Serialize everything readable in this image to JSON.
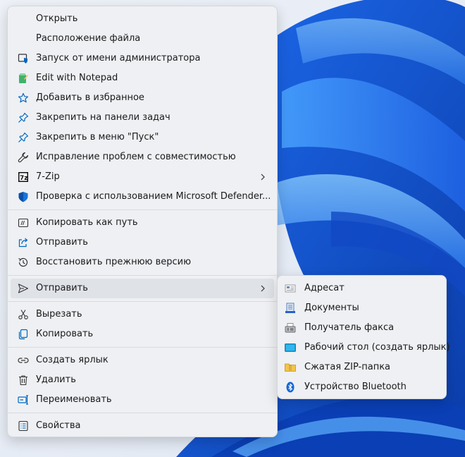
{
  "main_menu": {
    "group1": [
      {
        "label": "Открыть",
        "icon": "none"
      },
      {
        "label": "Расположение файла",
        "icon": "none"
      },
      {
        "label": "Запуск от имени администратора",
        "icon": "admin-shield-icon"
      },
      {
        "label": "Edit with Notepad",
        "icon": "notepad-icon"
      },
      {
        "label": "Добавить в избранное",
        "icon": "star-icon"
      },
      {
        "label": "Закрепить на панели задач",
        "icon": "pin-icon"
      },
      {
        "label": "Закрепить в меню \"Пуск\"",
        "icon": "pin-icon"
      },
      {
        "label": "Исправление проблем с совместимостью",
        "icon": "wrench-icon"
      },
      {
        "label": "7-Zip",
        "icon": "7zip-icon",
        "has_submenu": true
      },
      {
        "label": "Проверка с использованием Microsoft Defender...",
        "icon": "defender-shield-icon"
      }
    ],
    "group2": [
      {
        "label": "Копировать как путь",
        "icon": "copy-path-icon"
      },
      {
        "label": "Отправить",
        "icon": "share-icon"
      },
      {
        "label": "Восстановить прежнюю версию",
        "icon": "history-icon"
      }
    ],
    "group3": [
      {
        "label": "Отправить",
        "icon": "send-icon",
        "has_submenu": true,
        "highlighted": true
      }
    ],
    "group4": [
      {
        "label": "Вырезать",
        "icon": "scissors-icon"
      },
      {
        "label": "Копировать",
        "icon": "copy-icon"
      }
    ],
    "group5": [
      {
        "label": "Создать ярлык",
        "icon": "link-icon"
      },
      {
        "label": "Удалить",
        "icon": "trash-icon"
      },
      {
        "label": "Переименовать",
        "icon": "rename-icon"
      }
    ],
    "group6": [
      {
        "label": "Свойства",
        "icon": "properties-icon"
      }
    ]
  },
  "sub_menu": [
    {
      "label": "Адресат",
      "icon": "contact-icon"
    },
    {
      "label": "Документы",
      "icon": "documents-icon"
    },
    {
      "label": "Получатель факса",
      "icon": "fax-icon"
    },
    {
      "label": "Рабочий стол (создать ярлык)",
      "icon": "desktop-icon"
    },
    {
      "label": "Сжатая ZIP-папка",
      "icon": "zip-folder-icon"
    },
    {
      "label": "Устройство Bluetooth",
      "icon": "bluetooth-icon"
    }
  ],
  "colors": {
    "accent": "#0067c0",
    "wallpaper_deep": "#0a3fb5",
    "wallpaper_light": "#7fc3ff"
  }
}
